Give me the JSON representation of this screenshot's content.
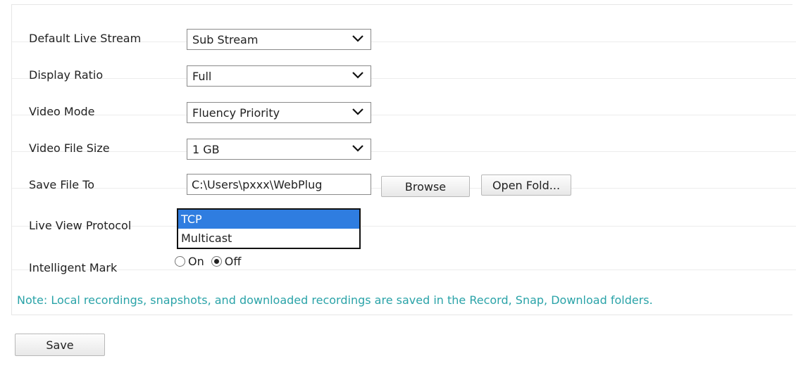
{
  "form": {
    "rows": [
      {
        "label": "Default Live Stream",
        "value": "Sub Stream"
      },
      {
        "label": "Display Ratio",
        "value": "Full"
      },
      {
        "label": "Video Mode",
        "value": "Fluency Priority"
      },
      {
        "label": "Video File Size",
        "value": "1 GB"
      }
    ],
    "save_file_to": {
      "label": "Save File To",
      "path": "C:\\Users\\pxxx\\WebPlug",
      "browse_label": "Browse",
      "open_folder_label": "Open Fold..."
    },
    "live_view_protocol": {
      "label": "Live View Protocol",
      "options": [
        "TCP",
        "Multicast"
      ],
      "highlighted_option": "TCP"
    },
    "intelligent_mark": {
      "label": "Intelligent Mark",
      "on_label": "On",
      "off_label": "Off",
      "selected": "Off"
    },
    "note": "Note: Local recordings, snapshots, and downloaded recordings are saved in the Record, Snap, Download folders.",
    "save_label": "Save"
  },
  "colors": {
    "note_text": "#2aa3a8",
    "selected_option": "#2f7de0"
  },
  "icons": {
    "select_arrow": "chevron-down-icon"
  }
}
